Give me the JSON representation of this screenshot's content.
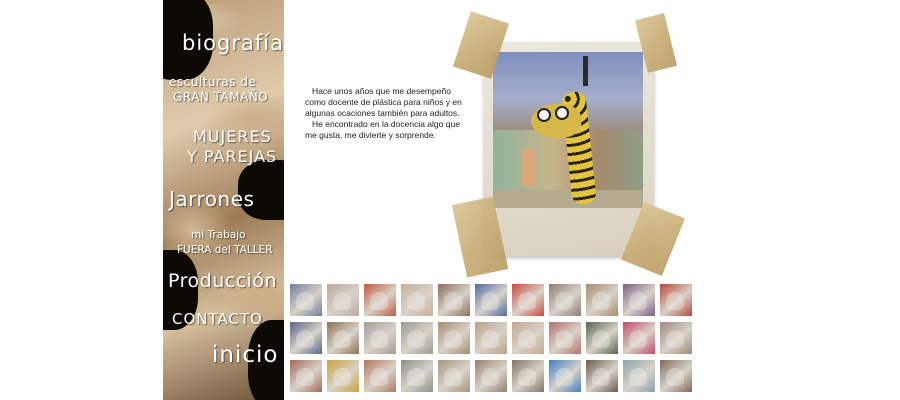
{
  "nav": {
    "biografia": "biografía",
    "esculturas_line1": "esculturas de",
    "esculturas_line2": "GRAN TAMAÑO",
    "mujeres_line1": "MUJERES",
    "mujeres_line2": "Y PAREJAS",
    "jarrones": "Jarrones",
    "trabajo_line1": "mi Trabajo",
    "trabajo_line2": "FUERA del TALLER",
    "produccion": "Producción",
    "contacto": "CONTACTO",
    "inicio": "inicio"
  },
  "intro": {
    "paragraph1": "Hace unos años que me desempeño como docente de plástica para niños y en algunas ocaciones también para adultos.",
    "paragraph2": "He encontrado en la docencia algo que me gusta, me divierte y sorprende."
  },
  "colors": {
    "sidebar_dark": "#0d0905",
    "text": "#222222",
    "tape": "#c9ad76",
    "polaroid": "#e6e0d2"
  },
  "thumbnails": [
    {
      "color": "#6f7f9a"
    },
    {
      "color": "#b8a9a0"
    },
    {
      "color": "#c45a3b"
    },
    {
      "color": "#c9b19b"
    },
    {
      "color": "#8c6d5d"
    },
    {
      "color": "#4f6aa2"
    },
    {
      "color": "#c84a3f"
    },
    {
      "color": "#8f7d74"
    },
    {
      "color": "#a98a70"
    },
    {
      "color": "#7c5f82"
    },
    {
      "color": "#b9473c"
    },
    {
      "color": "#566487"
    },
    {
      "color": "#8f6f55"
    },
    {
      "color": "#a59d96"
    },
    {
      "color": "#9a9c93"
    },
    {
      "color": "#a88b76"
    },
    {
      "color": "#bba18a"
    },
    {
      "color": "#c4a690"
    },
    {
      "color": "#b66f6f"
    },
    {
      "color": "#55664f"
    },
    {
      "color": "#c34a6a"
    },
    {
      "color": "#9f8a7e"
    },
    {
      "color": "#a36a5a"
    },
    {
      "color": "#c9a23a"
    },
    {
      "color": "#b27862"
    },
    {
      "color": "#8a8f88"
    },
    {
      "color": "#a49580"
    },
    {
      "color": "#94826e"
    },
    {
      "color": "#7f7566"
    },
    {
      "color": "#3d7fc4"
    },
    {
      "color": "#6a5a52"
    },
    {
      "color": "#8aa4b0"
    },
    {
      "color": "#7e6b5c"
    }
  ]
}
